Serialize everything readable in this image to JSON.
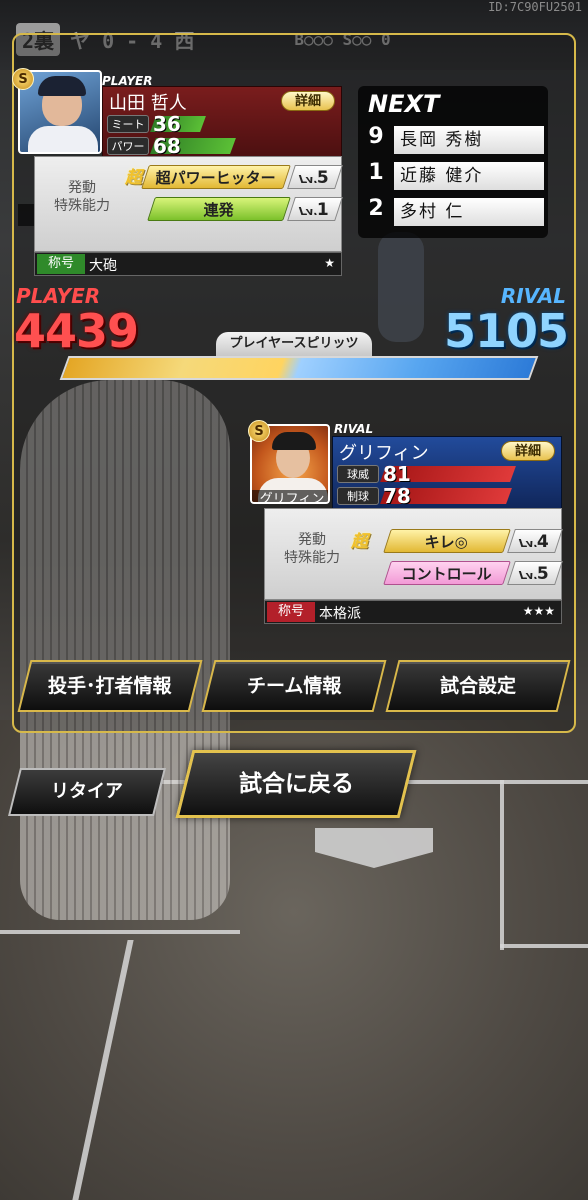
{
  "scoreboard": {
    "inning": "2裏",
    "score_text": "ヤ 0 - 4 西",
    "bso": "B○○○ S○○ 0",
    "id_text": "ID:7C90FU2501"
  },
  "player": {
    "header": "PLAYER",
    "short_name": "山 田",
    "name": "山田 哲人",
    "detail_label": "詳細",
    "stats": [
      {
        "label": "ミート",
        "value": "36"
      },
      {
        "label": "パワー",
        "value": "68"
      }
    ],
    "ability_caption": "発動\n特殊能力",
    "abilities": [
      {
        "super": "超",
        "name": "超パワーヒッター",
        "lv_prefix": "Lv.",
        "lv": "5"
      },
      {
        "name": "連発",
        "lv_prefix": "Lv.",
        "lv": "1"
      }
    ],
    "title_tag": "称号",
    "title_value": "大砲",
    "title_stars": "★",
    "side_label": "PLAYER",
    "spirits": "4439"
  },
  "next": {
    "title": "NEXT",
    "batters": [
      {
        "num": "9",
        "name": "長岡 秀樹"
      },
      {
        "num": "1",
        "name": "近藤 健介"
      },
      {
        "num": "2",
        "name": "多村 仁"
      }
    ]
  },
  "spirits_label": "プレイヤースピリッツ",
  "rival": {
    "header": "RIVAL",
    "short_name": "グリフィン",
    "name": "グリフィン",
    "detail_label": "詳細",
    "stats": [
      {
        "label": "球威",
        "value": "81"
      },
      {
        "label": "制球",
        "value": "78"
      }
    ],
    "ability_caption": "発動\n特殊能力",
    "abilities": [
      {
        "super": "超",
        "name": "キレ◎",
        "lv_prefix": "Lv.",
        "lv": "4"
      },
      {
        "name": "コントロール",
        "lv_prefix": "Lv.",
        "lv": "5"
      }
    ],
    "title_tag": "称号",
    "title_value": "本格派",
    "title_stars": "★★★",
    "side_label": "RIVAL",
    "spirits": "5105"
  },
  "buttons": {
    "pitcher_batter_info": "投手･打者情報",
    "team_info": "チーム情報",
    "game_settings": "試合設定",
    "retire": "リタイア",
    "return_to_game": "試合に戻る"
  },
  "colors": {
    "frame_gold": "#d6b94a",
    "player_red": "#ff5050",
    "rival_blue": "#8fd4ff"
  }
}
